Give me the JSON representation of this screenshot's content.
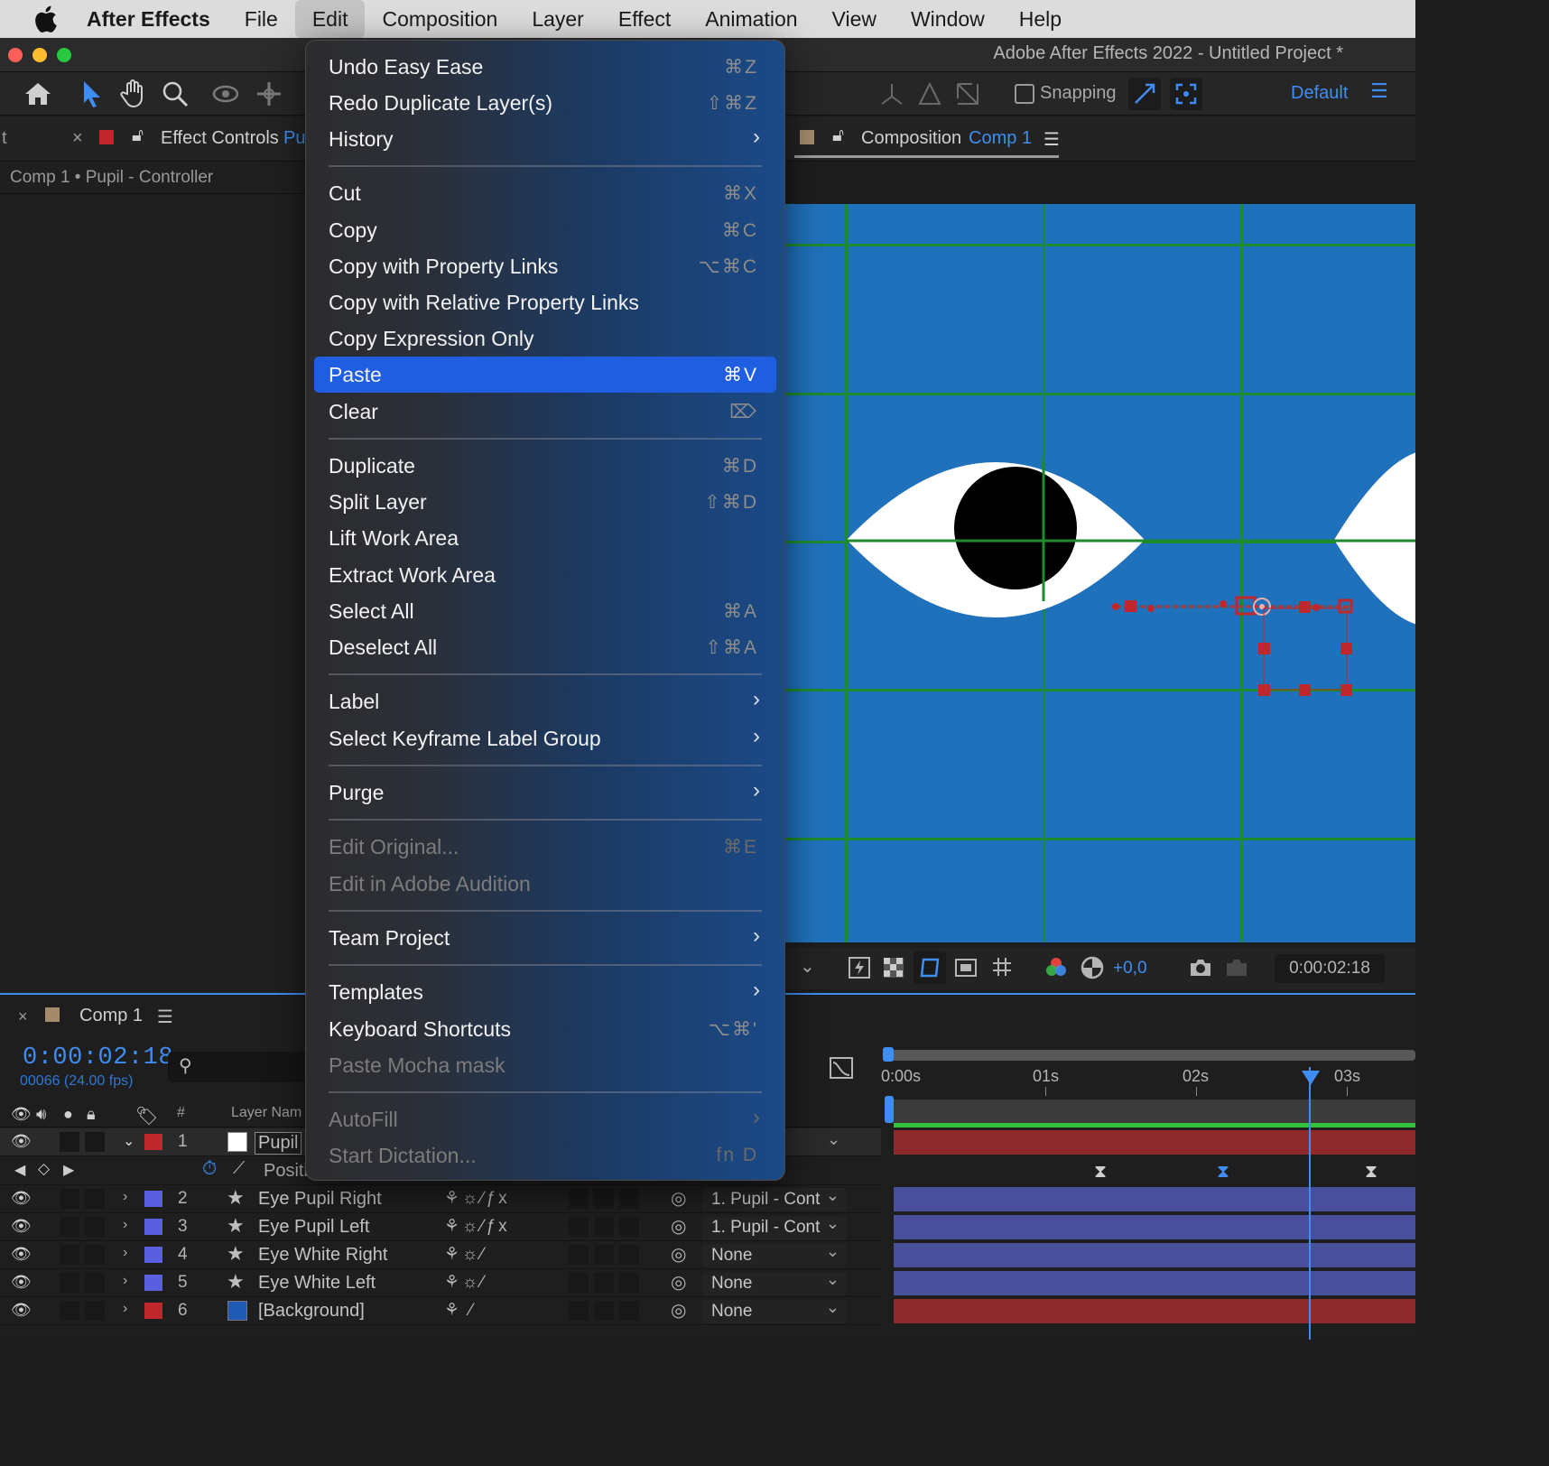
{
  "menubar": {
    "app": "After Effects",
    "items": [
      "File",
      "Edit",
      "Composition",
      "Layer",
      "Effect",
      "Animation",
      "View",
      "Window",
      "Help"
    ]
  },
  "window": {
    "title": "Adobe After Effects 2022 - Untitled Project *"
  },
  "toolbar": {
    "snapping_label": "Snapping",
    "workspace": "Default"
  },
  "panels": {
    "left_tab_fragment": "t",
    "effect_controls_tab": "Effect Controls",
    "effect_controls_layer": "Pu",
    "effect_controls_sub": "Comp 1 • Pupil - Controller",
    "composition_tab": "Composition",
    "composition_name": "Comp 1"
  },
  "viewer": {
    "exposure_offset": "+0,0",
    "time": "0:00:02:18"
  },
  "edit_menu": {
    "items": [
      {
        "label": "Undo Easy Ease",
        "shortcut": "⌘Z",
        "submenu": false,
        "disabled": false,
        "highlight": false
      },
      {
        "label": "Redo Duplicate Layer(s)",
        "shortcut": "⇧⌘Z",
        "submenu": false,
        "disabled": false,
        "highlight": false
      },
      {
        "label": "History",
        "shortcut": "",
        "submenu": true,
        "disabled": false,
        "highlight": false
      },
      {
        "label": "Cut",
        "shortcut": "⌘X",
        "submenu": false,
        "disabled": false,
        "highlight": false
      },
      {
        "label": "Copy",
        "shortcut": "⌘C",
        "submenu": false,
        "disabled": false,
        "highlight": false
      },
      {
        "label": "Copy with Property Links",
        "shortcut": "⌥⌘C",
        "submenu": false,
        "disabled": false,
        "highlight": false
      },
      {
        "label": "Copy with Relative Property Links",
        "shortcut": "",
        "submenu": false,
        "disabled": false,
        "highlight": false
      },
      {
        "label": "Copy Expression Only",
        "shortcut": "",
        "submenu": false,
        "disabled": false,
        "highlight": false
      },
      {
        "label": "Paste",
        "shortcut": "⌘V",
        "submenu": false,
        "disabled": false,
        "highlight": true
      },
      {
        "label": "Clear",
        "shortcut": "⌦",
        "submenu": false,
        "disabled": false,
        "highlight": false
      },
      {
        "label": "Duplicate",
        "shortcut": "⌘D",
        "submenu": false,
        "disabled": false,
        "highlight": false
      },
      {
        "label": "Split Layer",
        "shortcut": "⇧⌘D",
        "submenu": false,
        "disabled": false,
        "highlight": false
      },
      {
        "label": "Lift Work Area",
        "shortcut": "",
        "submenu": false,
        "disabled": false,
        "highlight": false
      },
      {
        "label": "Extract Work Area",
        "shortcut": "",
        "submenu": false,
        "disabled": false,
        "highlight": false
      },
      {
        "label": "Select All",
        "shortcut": "⌘A",
        "submenu": false,
        "disabled": false,
        "highlight": false
      },
      {
        "label": "Deselect All",
        "shortcut": "⇧⌘A",
        "submenu": false,
        "disabled": false,
        "highlight": false
      },
      {
        "label": "Label",
        "shortcut": "",
        "submenu": true,
        "disabled": false,
        "highlight": false
      },
      {
        "label": "Select Keyframe Label Group",
        "shortcut": "",
        "submenu": true,
        "disabled": false,
        "highlight": false
      },
      {
        "label": "Purge",
        "shortcut": "",
        "submenu": true,
        "disabled": false,
        "highlight": false
      },
      {
        "label": "Edit Original...",
        "shortcut": "⌘E",
        "submenu": false,
        "disabled": true,
        "highlight": false
      },
      {
        "label": "Edit in Adobe Audition",
        "shortcut": "",
        "submenu": false,
        "disabled": true,
        "highlight": false
      },
      {
        "label": "Team Project",
        "shortcut": "",
        "submenu": true,
        "disabled": false,
        "highlight": false
      },
      {
        "label": "Templates",
        "shortcut": "",
        "submenu": true,
        "disabled": false,
        "highlight": false
      },
      {
        "label": "Keyboard Shortcuts",
        "shortcut": "⌥⌘'",
        "submenu": false,
        "disabled": false,
        "highlight": false
      },
      {
        "label": "Paste Mocha mask",
        "shortcut": "",
        "submenu": false,
        "disabled": true,
        "highlight": false
      },
      {
        "label": "AutoFill",
        "shortcut": "",
        "submenu": true,
        "disabled": true,
        "highlight": false
      },
      {
        "label": "Start Dictation...",
        "shortcut": "fn D",
        "submenu": false,
        "disabled": true,
        "highlight": false
      }
    ]
  },
  "timeline": {
    "tab": "Comp 1",
    "timecode": "0:00:02:18",
    "frames": "00066 (24.00 fps)",
    "col_number": "#",
    "col_layer_name": "Layer Nam",
    "ruler": [
      "0:00s",
      "01s",
      "02s",
      "03s"
    ],
    "property_fragment": "Positi",
    "layers": [
      {
        "num": "1",
        "name": "Pupil",
        "color": "#c0272d"
      },
      {
        "num": "2",
        "name": "Eye Pupil Right",
        "color": "#5a5fe0",
        "parent": "1. Pupil - Cont"
      },
      {
        "num": "3",
        "name": "Eye Pupil Left",
        "color": "#5a5fe0",
        "parent": "1. Pupil - Cont"
      },
      {
        "num": "4",
        "name": "Eye White Right",
        "color": "#5a5fe0",
        "parent": "None"
      },
      {
        "num": "5",
        "name": "Eye White Left",
        "color": "#5a5fe0",
        "parent": "None"
      },
      {
        "num": "6",
        "name": "[Background]",
        "color": "#c0272d",
        "parent": "None"
      }
    ]
  },
  "colors": {
    "accent": "#3f8df2",
    "comp_bg": "#2071bb",
    "grid": "#1d8a2e",
    "menu_highlight": "#1f5ee0"
  }
}
